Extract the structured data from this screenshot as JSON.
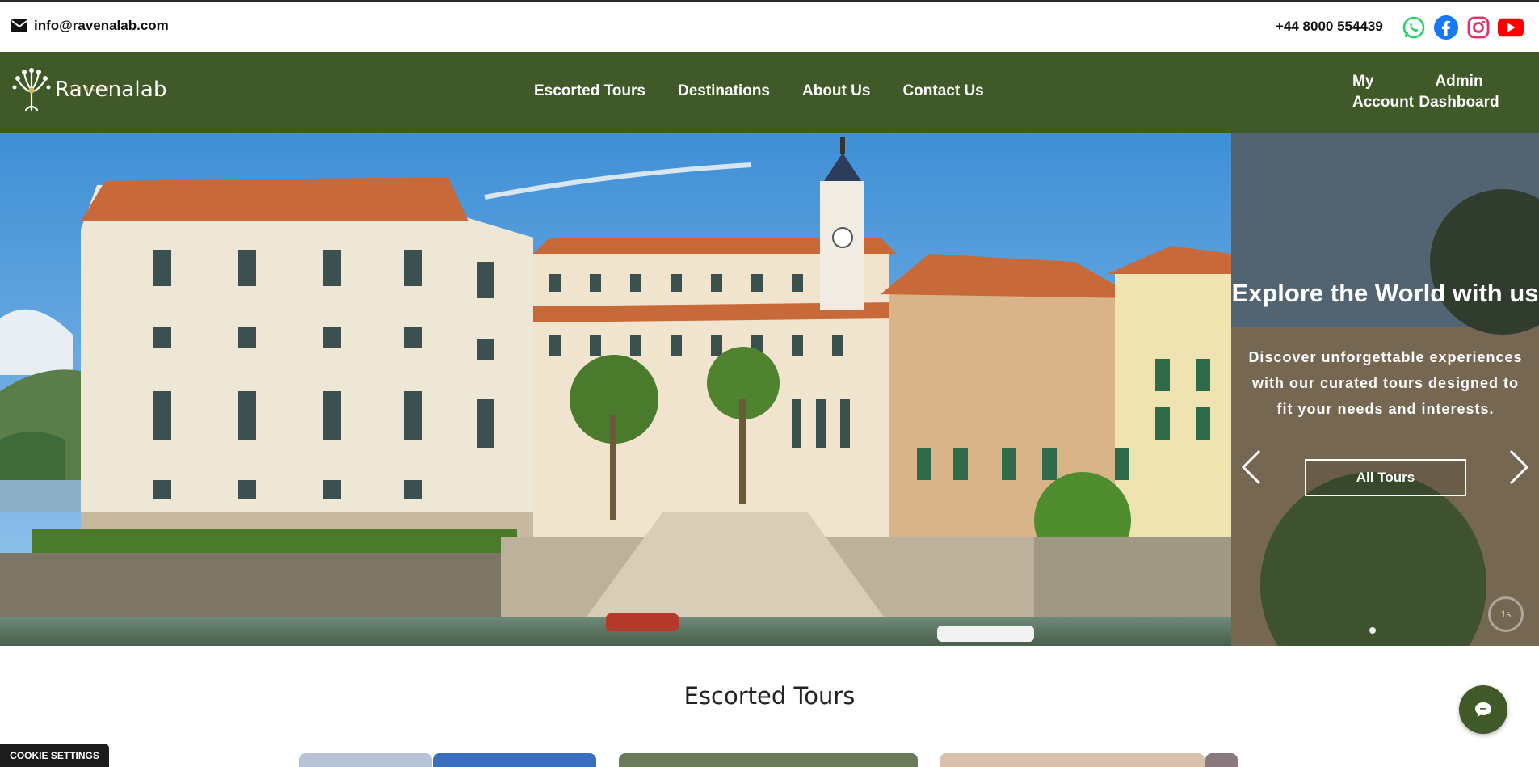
{
  "topbar": {
    "email": "info@ravenalab.com",
    "phone": "+44 8000 554439",
    "socials": [
      {
        "icon": "whatsapp-icon",
        "color": "#25d366"
      },
      {
        "icon": "facebook-icon",
        "color": "#1877f2"
      },
      {
        "icon": "instagram-icon",
        "color": "#e1306c"
      },
      {
        "icon": "youtube-icon",
        "color": "#ff0000"
      }
    ]
  },
  "nav": {
    "brand": "Ravenalab",
    "brand_sub": "TRAVEL",
    "items": [
      "Escorted Tours",
      "Destinations",
      "About Us",
      "Contact Us"
    ],
    "my_account": "My Account",
    "my_account_line1": "My",
    "my_account_line2": "Account",
    "admin_line1": "Admin",
    "admin_line2": "Dashboard",
    "bg_color": "#3f5a28"
  },
  "hero": {
    "title": "Explore the World with us",
    "text": "Discover unforgettable experiences with our curated tours designed to fit your needs and interests.",
    "button": "All Tours",
    "timer": "1s"
  },
  "section": {
    "title": "Escorted Tours"
  },
  "cookie": {
    "label": "COOKIE SETTINGS"
  }
}
